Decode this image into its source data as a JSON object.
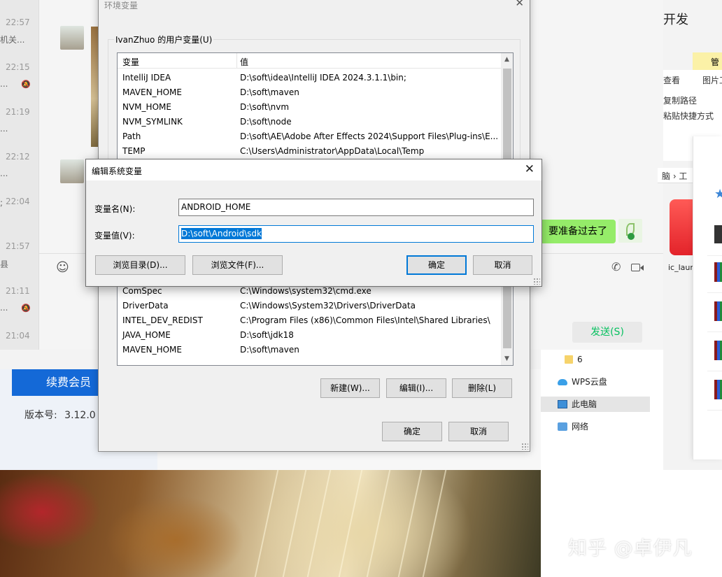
{
  "chat": {
    "times": [
      "22:57",
      "22:15",
      "21:19",
      "22:12",
      "22:04",
      "21:57",
      "21:11",
      "21:04"
    ],
    "snippets": [
      "机关...",
      "...",
      "...",
      "...",
      ";",
      "县",
      "..."
    ],
    "bubble_text": "要准备过去了",
    "send_label": "发送(S)"
  },
  "explorer": {
    "title": "开发",
    "ribbon_tab": "管理",
    "ribbon_items": [
      "查看",
      "图片工",
      "复制路径",
      "粘贴快捷方式"
    ],
    "addr_text": "脑 › 工",
    "app_label": "ic_laun",
    "nav": [
      {
        "label": "6",
        "icon": "folder-icon"
      },
      {
        "label": "WPS云盘",
        "icon": "cloud-icon"
      },
      {
        "label": "此电脑",
        "icon": "computer-icon"
      },
      {
        "label": "网络",
        "icon": "network-icon"
      }
    ]
  },
  "left_app": {
    "renew_label": "续费会员",
    "version_label": "版本号:",
    "version": "3.12.0"
  },
  "env_dialog": {
    "title": "环境变量",
    "user_group_label": "IvanZhuo 的用户变量(U)",
    "col_name": "变量",
    "col_value": "值",
    "user_vars": [
      {
        "name": "IntelliJ IDEA",
        "value": "D:\\soft\\idea\\IntelliJ IDEA 2024.3.1.1\\bin;"
      },
      {
        "name": "MAVEN_HOME",
        "value": "D:\\soft\\maven"
      },
      {
        "name": "NVM_HOME",
        "value": "D:\\soft\\nvm"
      },
      {
        "name": "NVM_SYMLINK",
        "value": "D:\\soft\\node"
      },
      {
        "name": "Path",
        "value": "D:\\soft\\AE\\Adobe After Effects 2024\\Support Files\\Plug-ins\\E..."
      },
      {
        "name": "TEMP",
        "value": "C:\\Users\\Administrator\\AppData\\Local\\Temp"
      }
    ],
    "system_vars": [
      {
        "name": "ComSpec",
        "value": "C:\\Windows\\system32\\cmd.exe"
      },
      {
        "name": "DriverData",
        "value": "C:\\Windows\\System32\\Drivers\\DriverData"
      },
      {
        "name": "INTEL_DEV_REDIST",
        "value": "C:\\Program Files (x86)\\Common Files\\Intel\\Shared Libraries\\"
      },
      {
        "name": "JAVA_HOME",
        "value": "D:\\soft\\jdk18"
      },
      {
        "name": "MAVEN_HOME",
        "value": "D:\\soft\\maven"
      }
    ],
    "new_label": "新建(W)...",
    "edit_label": "编辑(I)...",
    "delete_label": "删除(L)",
    "ok_label": "确定",
    "cancel_label": "取消"
  },
  "edit_dialog": {
    "title": "编辑系统变量",
    "name_label": "变量名(N):",
    "name_value": "ANDROID_HOME",
    "value_label": "变量值(V):",
    "value_value": "D:\\soft\\Android\\sdk",
    "browse_dir_label": "浏览目录(D)...",
    "browse_file_label": "浏览文件(F)...",
    "ok_label": "确定",
    "cancel_label": "取消"
  },
  "watermark": "知乎 @卓伊凡",
  "colors": {
    "accent": "#0078d7",
    "chat_bubble": "#95ec69",
    "renew": "#1469d7",
    "send_text": "#07c160"
  }
}
